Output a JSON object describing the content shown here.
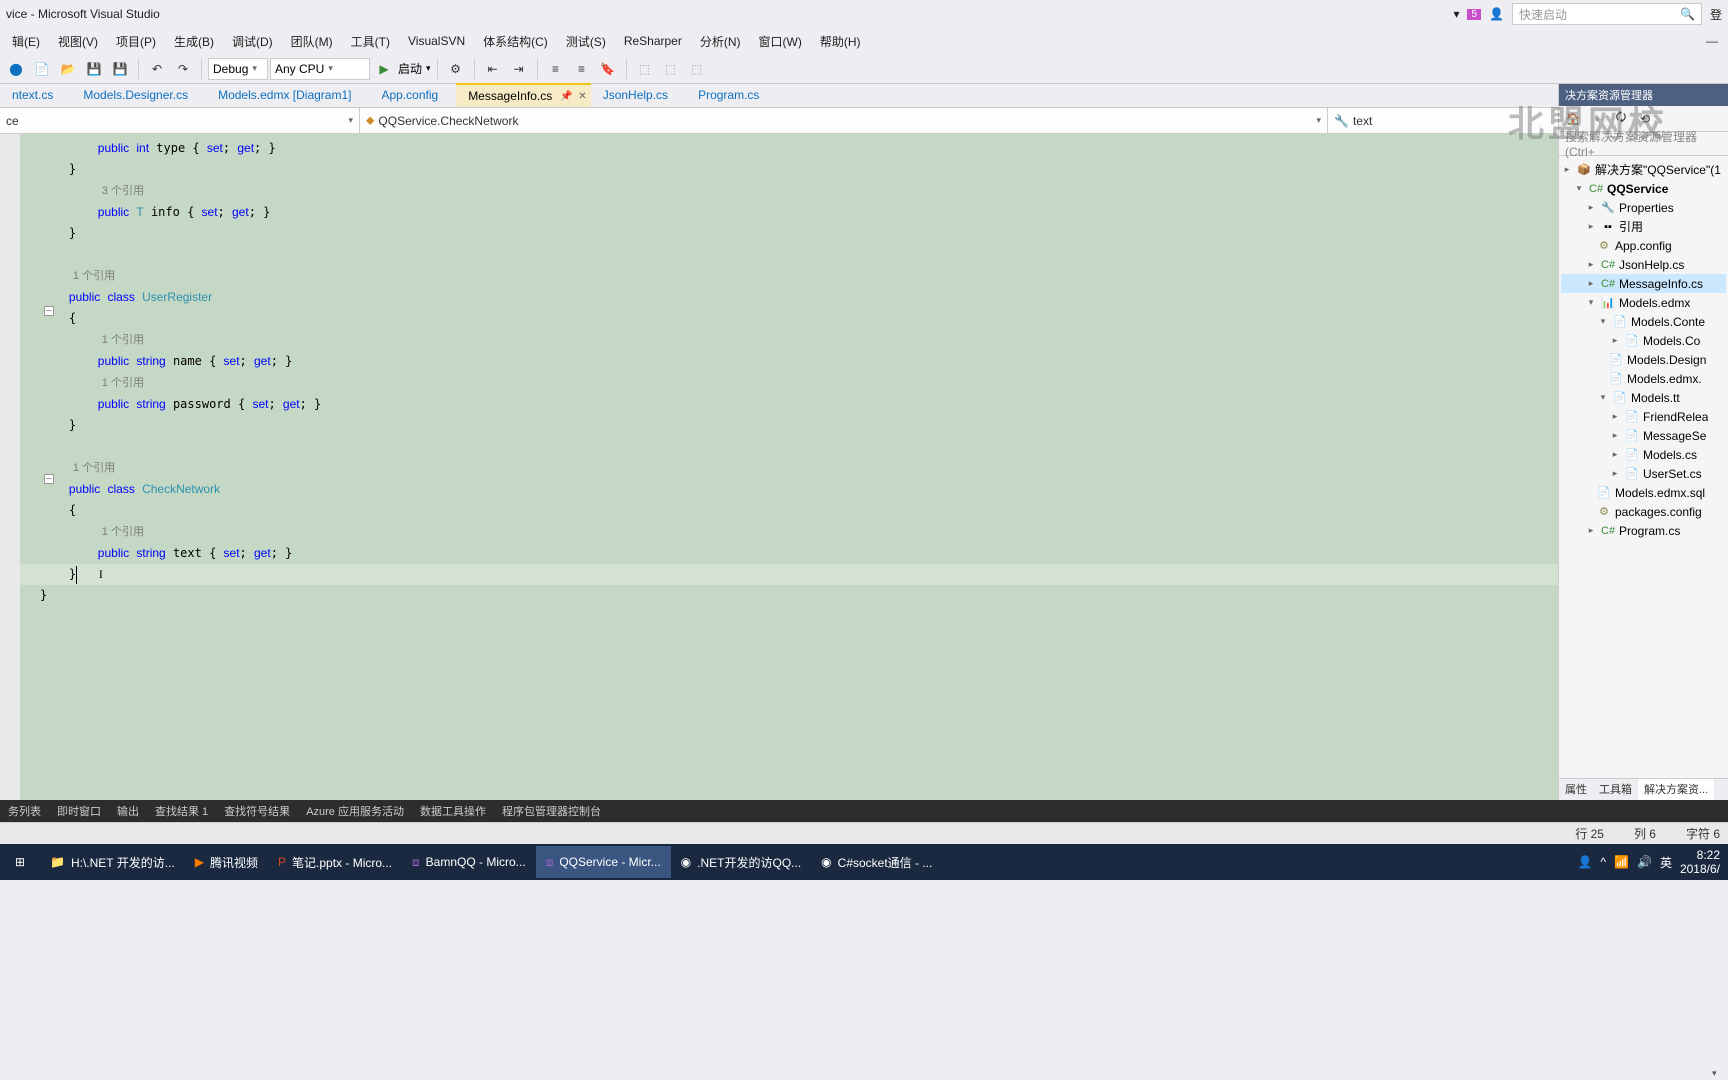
{
  "title": "vice - Microsoft Visual Studio",
  "quicklaunch_placeholder": "快速启动",
  "notif_badge": "5",
  "menus": [
    "辑(E)",
    "视图(V)",
    "项目(P)",
    "生成(B)",
    "调试(D)",
    "团队(M)",
    "工具(T)",
    "VisualSVN",
    "体系结构(C)",
    "测试(S)",
    "ReSharper",
    "分析(N)",
    "窗口(W)",
    "帮助(H)"
  ],
  "toolbar": {
    "config": "Debug",
    "platform": "Any CPU",
    "start_label": "启动"
  },
  "tabs": [
    {
      "label": "ntext.cs"
    },
    {
      "label": "Models.Designer.cs"
    },
    {
      "label": "Models.edmx [Diagram1]"
    },
    {
      "label": "App.config"
    },
    {
      "label": "MessageInfo.cs",
      "active": true
    },
    {
      "label": "JsonHelp.cs"
    },
    {
      "label": "Program.cs"
    }
  ],
  "nav_combo": {
    "first": "ce",
    "second": "QQService.CheckNetwork",
    "third": "text"
  },
  "code_refs": {
    "r1": "1 个引用",
    "r3": "3 个引用"
  },
  "solution": {
    "panel_title": "决方案资源管理器",
    "search_placeholder": "搜索解决方案资源管理器(Ctrl+",
    "root": "解决方案\"QQService\"(1 ",
    "proj": "QQService",
    "items": [
      "Properties",
      "引用",
      "App.config",
      "JsonHelp.cs",
      "MessageInfo.cs",
      "Models.edmx",
      "Models.Conte",
      "Models.Co",
      "Models.Design",
      "Models.edmx.",
      "Models.tt",
      "FriendRelea",
      "MessageSe",
      "Models.cs",
      "UserSet.cs",
      "Models.edmx.sql",
      "packages.config",
      "Program.cs"
    ],
    "prop_tabs": [
      "属性",
      "工具箱",
      "解决方案资..."
    ]
  },
  "bottom_tabs": [
    "务列表",
    "即时窗口",
    "输出",
    "查找结果 1",
    "查找符号结果",
    "Azure 应用服务活动",
    "数据工具操作",
    "程序包管理器控制台"
  ],
  "statusbar": {
    "line": "行 25",
    "col": "列 6",
    "char": "字符 6"
  },
  "taskbar": [
    {
      "label": "H:\\.NET 开发的访..."
    },
    {
      "label": "腾讯视频"
    },
    {
      "label": "笔记.pptx - Micro..."
    },
    {
      "label": "BamnQQ - Micro..."
    },
    {
      "label": "QQService - Micr...",
      "active": true
    },
    {
      "label": ".NET开发的访QQ..."
    },
    {
      "label": "C#socket通信 - ..."
    }
  ],
  "tray": {
    "time": "8:22",
    "date": "2018/6/",
    "ime": "英"
  },
  "watermark": "北盟网校"
}
